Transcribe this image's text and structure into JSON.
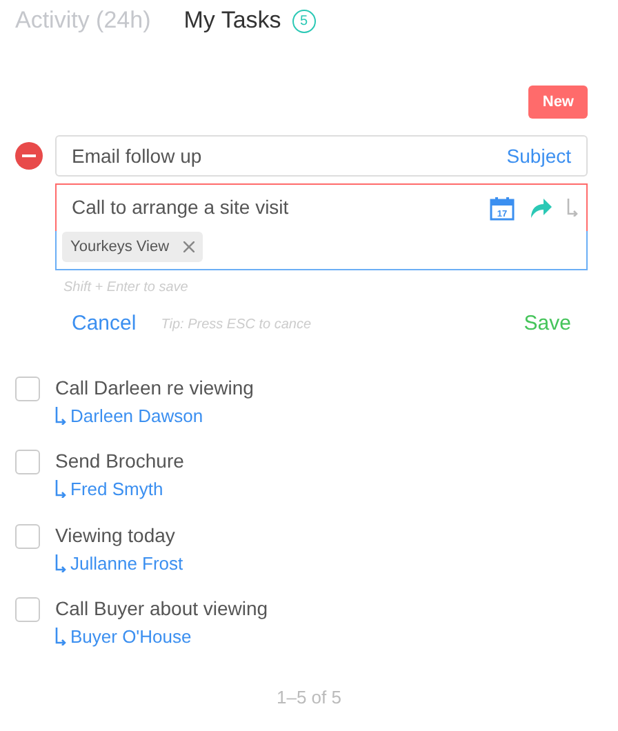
{
  "tabs": [
    {
      "label": "Activity (24h)",
      "selected": false
    },
    {
      "label": "My Tasks",
      "selected": true,
      "count": "5"
    }
  ],
  "new_button": "New",
  "subject_field": {
    "value": "Email follow up",
    "link": "Subject"
  },
  "task_field": {
    "value": "Call to arrange a site visit",
    "date_icon_text": "17",
    "tags": [
      "Yourkeys View"
    ]
  },
  "hint": "Shift + Enter to save",
  "actions": {
    "cancel": "Cancel",
    "tip": "Tip: Press ESC to cance",
    "save": "Save"
  },
  "tasks": [
    {
      "title": "Call Darleen re viewing",
      "contact": "Darleen Dawson",
      "checked": false
    },
    {
      "title": "Send Brochure",
      "contact": "Fred Smyth",
      "checked": false
    },
    {
      "title": "Viewing today",
      "contact": "Jullanne Frost",
      "checked": false
    },
    {
      "title": "Call Buyer about viewing",
      "contact": "Buyer O'House",
      "checked": false
    }
  ],
  "pagination": "1–5 of 5"
}
